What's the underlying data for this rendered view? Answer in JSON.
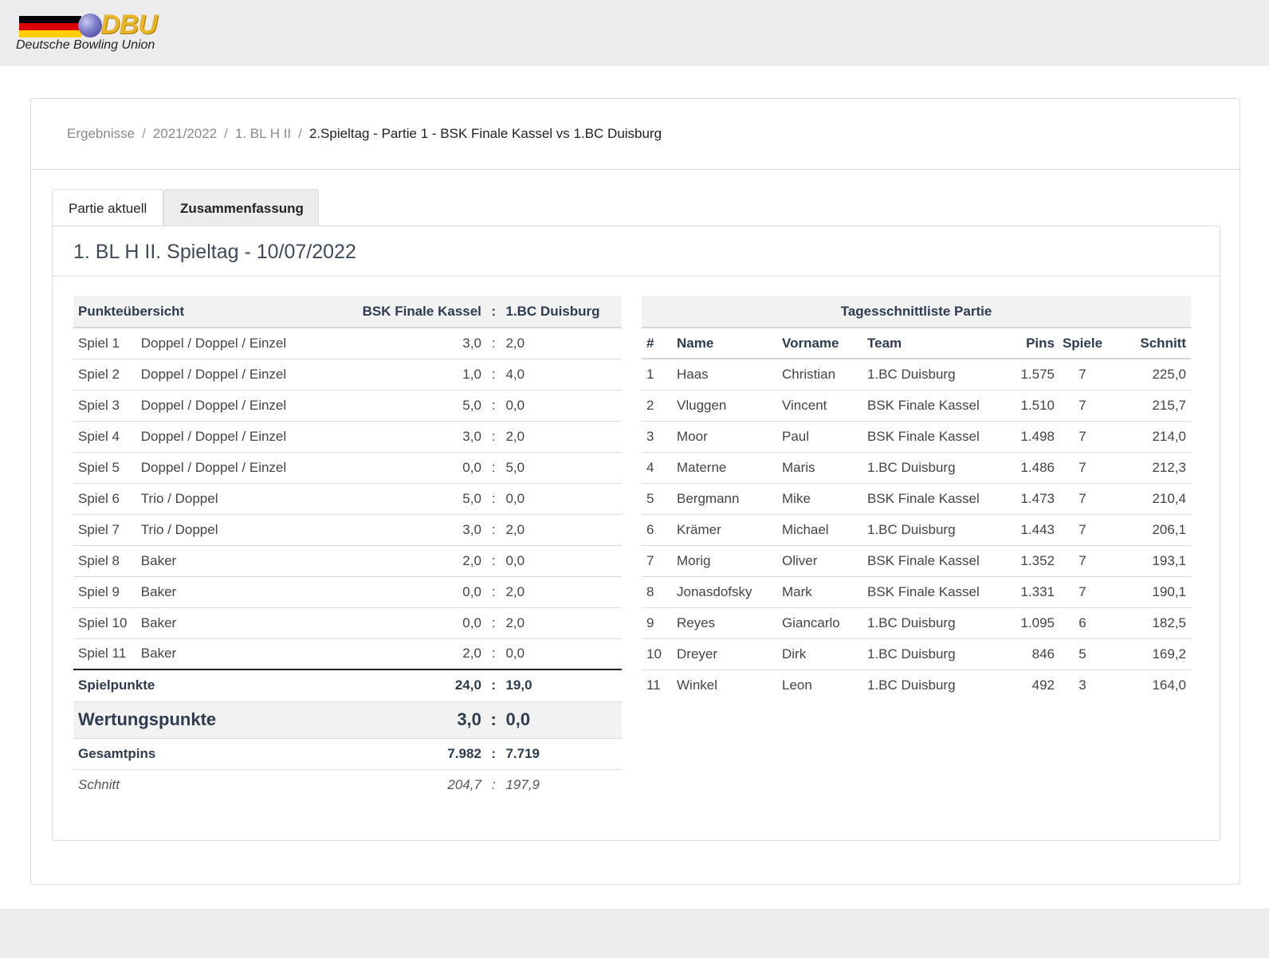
{
  "header": {
    "logo_text": "Deutsche Bowling Union",
    "logo_mark": "DBU",
    "flag_colors": [
      "#000000",
      "#dd0000",
      "#ffce00"
    ]
  },
  "breadcrumb": {
    "items": [
      "Ergebnisse",
      "2021/2022",
      "1. BL H II"
    ],
    "separator": "/",
    "current": "2.Spieltag - Partie 1 - BSK Finale Kassel vs 1.BC Duisburg"
  },
  "tabs": [
    {
      "label": "Partie aktuell",
      "active": false
    },
    {
      "label": "Zusammenfassung",
      "active": true
    }
  ],
  "panel": {
    "title": "1. BL H II. Spieltag - 10/07/2022"
  },
  "points": {
    "header": {
      "label": "Punkteübersicht",
      "team_a": "BSK Finale Kassel",
      "sep": ":",
      "team_b": "1.BC Duisburg"
    },
    "rows": [
      {
        "game": "Spiel 1",
        "type": "Doppel / Doppel / Einzel",
        "a": "3,0",
        "b": "2,0"
      },
      {
        "game": "Spiel 2",
        "type": "Doppel / Doppel / Einzel",
        "a": "1,0",
        "b": "4,0"
      },
      {
        "game": "Spiel 3",
        "type": "Doppel / Doppel / Einzel",
        "a": "5,0",
        "b": "0,0"
      },
      {
        "game": "Spiel 4",
        "type": "Doppel / Doppel / Einzel",
        "a": "3,0",
        "b": "2,0"
      },
      {
        "game": "Spiel 5",
        "type": "Doppel / Doppel / Einzel",
        "a": "0,0",
        "b": "5,0"
      },
      {
        "game": "Spiel 6",
        "type": "Trio / Doppel",
        "a": "5,0",
        "b": "0,0"
      },
      {
        "game": "Spiel 7",
        "type": "Trio / Doppel",
        "a": "3,0",
        "b": "2,0"
      },
      {
        "game": "Spiel 8",
        "type": "Baker",
        "a": "2,0",
        "b": "0,0"
      },
      {
        "game": "Spiel 9",
        "type": "Baker",
        "a": "0,0",
        "b": "2,0"
      },
      {
        "game": "Spiel 10",
        "type": "Baker",
        "a": "0,0",
        "b": "2,0"
      },
      {
        "game": "Spiel 11",
        "type": "Baker",
        "a": "2,0",
        "b": "0,0"
      }
    ],
    "spielpunkte": {
      "label": "Spielpunkte",
      "a": "24,0",
      "b": "19,0"
    },
    "wertungspunkte": {
      "label": "Wertungspunkte",
      "a": "3,0",
      "b": "0,0"
    },
    "gesamtpins": {
      "label": "Gesamtpins",
      "a": "7.982",
      "b": "7.719"
    },
    "schnitt": {
      "label": "Schnitt",
      "a": "204,7",
      "b": "197,9"
    }
  },
  "ranking": {
    "title": "Tagesschnittliste Partie",
    "columns": [
      "#",
      "Name",
      "Vorname",
      "Team",
      "Pins",
      "Spiele",
      "Schnitt"
    ],
    "rows": [
      [
        "1",
        "Haas",
        "Christian",
        "1.BC Duisburg",
        "1.575",
        "7",
        "225,0"
      ],
      [
        "2",
        "Vluggen",
        "Vincent",
        "BSK Finale Kassel",
        "1.510",
        "7",
        "215,7"
      ],
      [
        "3",
        "Moor",
        "Paul",
        "BSK Finale Kassel",
        "1.498",
        "7",
        "214,0"
      ],
      [
        "4",
        "Materne",
        "Maris",
        "1.BC Duisburg",
        "1.486",
        "7",
        "212,3"
      ],
      [
        "5",
        "Bergmann",
        "Mike",
        "BSK Finale Kassel",
        "1.473",
        "7",
        "210,4"
      ],
      [
        "6",
        "Krämer",
        "Michael",
        "1.BC Duisburg",
        "1.443",
        "7",
        "206,1"
      ],
      [
        "7",
        "Morig",
        "Oliver",
        "BSK Finale Kassel",
        "1.352",
        "7",
        "193,1"
      ],
      [
        "8",
        "Jonasdofsky",
        "Mark",
        "BSK Finale Kassel",
        "1.331",
        "7",
        "190,1"
      ],
      [
        "9",
        "Reyes",
        "Giancarlo",
        "1.BC Duisburg",
        "1.095",
        "6",
        "182,5"
      ],
      [
        "10",
        "Dreyer",
        "Dirk",
        "1.BC Duisburg",
        "846",
        "5",
        "169,2"
      ],
      [
        "11",
        "Winkel",
        "Leon",
        "1.BC Duisburg",
        "492",
        "3",
        "164,0"
      ]
    ]
  }
}
